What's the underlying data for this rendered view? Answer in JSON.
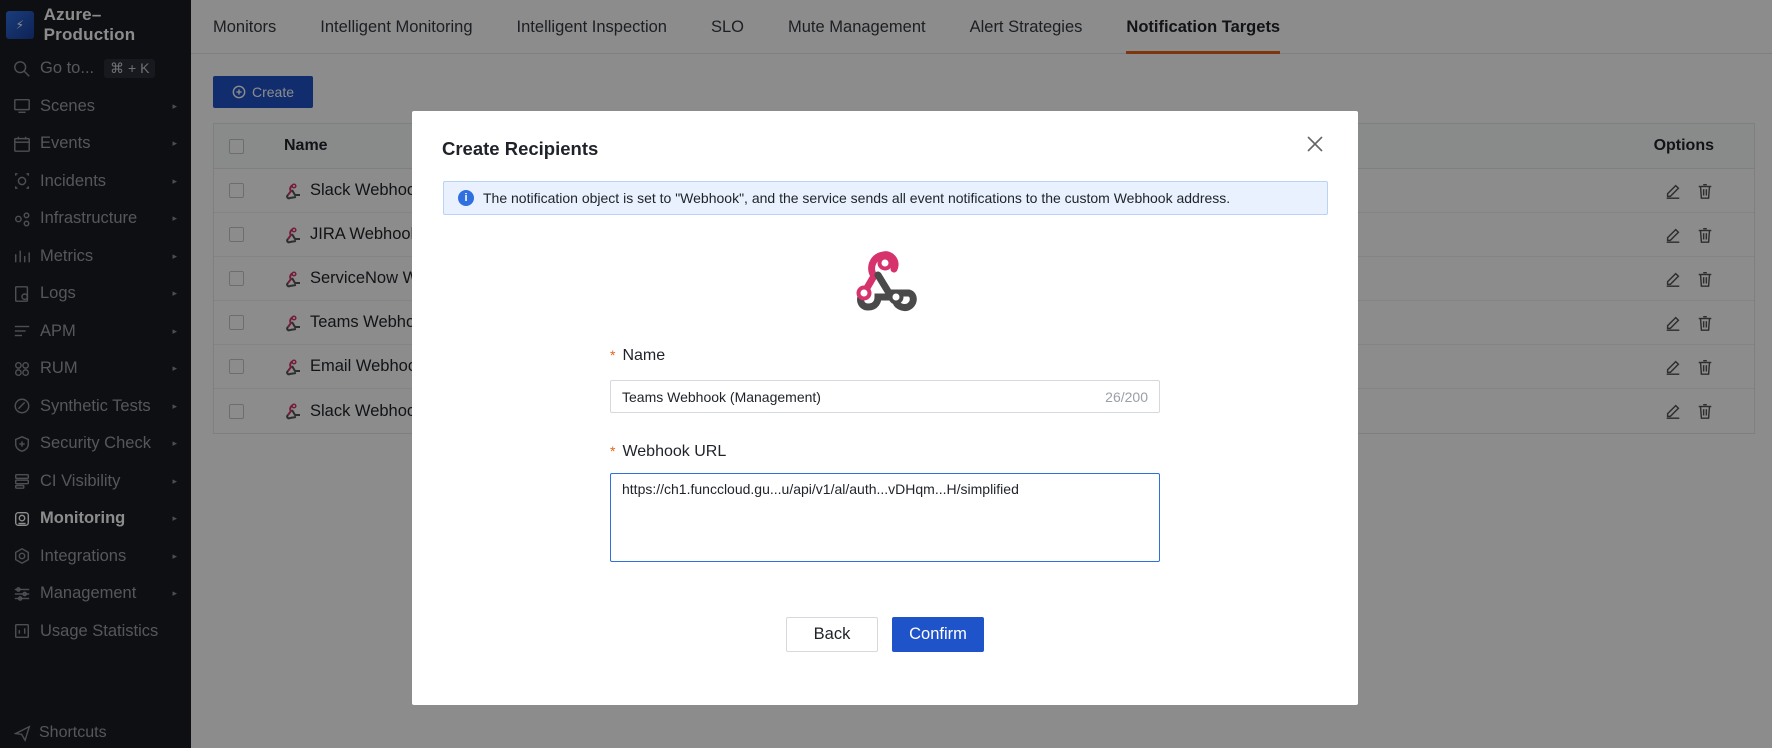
{
  "workspace": {
    "name": "Azure–Production"
  },
  "goto": {
    "label": "Go to...",
    "shortcut": "⌘ + K"
  },
  "sidebar": {
    "items": [
      {
        "label": "Scenes",
        "icon": "scenes-icon"
      },
      {
        "label": "Events",
        "icon": "calendar-icon"
      },
      {
        "label": "Incidents",
        "icon": "incidents-icon"
      },
      {
        "label": "Infrastructure",
        "icon": "infrastructure-icon"
      },
      {
        "label": "Metrics",
        "icon": "metrics-icon"
      },
      {
        "label": "Logs",
        "icon": "logs-icon"
      },
      {
        "label": "APM",
        "icon": "apm-icon"
      },
      {
        "label": "RUM",
        "icon": "rum-icon"
      },
      {
        "label": "Synthetic Tests",
        "icon": "synthetic-icon"
      },
      {
        "label": "Security Check",
        "icon": "shield-icon"
      },
      {
        "label": "CI Visibility",
        "icon": "ci-icon"
      },
      {
        "label": "Monitoring",
        "icon": "monitoring-icon",
        "active": true
      },
      {
        "label": "Integrations",
        "icon": "integrations-icon"
      },
      {
        "label": "Management",
        "icon": "management-icon"
      },
      {
        "label": "Usage Statistics",
        "icon": "usage-icon"
      }
    ],
    "shortcuts_label": "Shortcuts"
  },
  "tabs": [
    {
      "label": "Monitors"
    },
    {
      "label": "Intelligent Monitoring"
    },
    {
      "label": "Intelligent Inspection"
    },
    {
      "label": "SLO"
    },
    {
      "label": "Mute Management"
    },
    {
      "label": "Alert Strategies"
    },
    {
      "label": "Notification Targets",
      "active": true
    }
  ],
  "toolbar": {
    "create_label": "Create"
  },
  "table": {
    "headers": {
      "name": "Name",
      "options": "Options"
    },
    "rows": [
      {
        "name": "Slack Webhook"
      },
      {
        "name": "JIRA Webhook"
      },
      {
        "name": "ServiceNow We"
      },
      {
        "name": "Teams Webhook"
      },
      {
        "name": "Email Webhook"
      },
      {
        "name": "Slack Webhook"
      }
    ]
  },
  "modal": {
    "title": "Create Recipients",
    "info": "The notification object is set to \"Webhook\", and the service sends all event notifications to the custom Webhook address.",
    "name_label": "Name",
    "name_value": "Teams Webhook (Management)",
    "name_counter": "26/200",
    "url_label": "Webhook URL",
    "url_value": "https://ch1.funccloud.gu...u/api/v1/al/auth...vDHqm...H/simplified",
    "back_label": "Back",
    "confirm_label": "Confirm"
  },
  "colors": {
    "accent": "#1f53c9",
    "tab_indicator": "#e8631c",
    "sidebar_bg": "#1a1c22",
    "webhook_pink": "#d6336c"
  }
}
